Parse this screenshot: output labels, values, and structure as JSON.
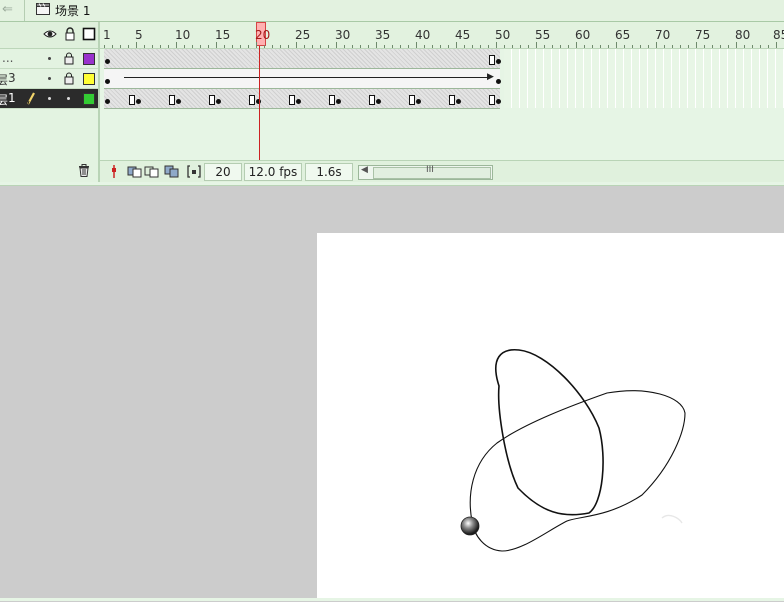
{
  "scene_bar": {
    "scene_label": "场景 1"
  },
  "layers": [
    {
      "name": "...",
      "prefix": "",
      "selected": false,
      "color": "#9933cc",
      "pencil": false
    },
    {
      "name": "3",
      "prefix": "层",
      "selected": false,
      "color": "#ffff33",
      "pencil": false
    },
    {
      "name": "1",
      "prefix": "层",
      "selected": true,
      "color": "#33cc33",
      "pencil": true
    }
  ],
  "ruler": {
    "labels": [
      "1",
      "5",
      "10",
      "15",
      "20",
      "25",
      "30",
      "35",
      "40",
      "45",
      "50",
      "55",
      "60",
      "65",
      "70",
      "75",
      "80",
      "85"
    ],
    "current_frame_label": "20"
  },
  "status": {
    "current_frame": "20",
    "frame_rate": "12.0 fps",
    "elapsed_time": "1.6s",
    "scroll_grip": "III"
  },
  "colors": {
    "playhead": "#cc2222",
    "timeline_bg": "#e6f5e5",
    "stage_bg": "#ffffff",
    "workspace_bg": "#cccccc"
  },
  "icons": [
    "eye-icon",
    "lock-icon",
    "outline-icon",
    "pencil-icon",
    "trash-icon",
    "scene-icon",
    "onion-skin-icon",
    "edit-multiple-frames-icon",
    "modify-onion-markers-icon",
    "center-frame-icon"
  ]
}
